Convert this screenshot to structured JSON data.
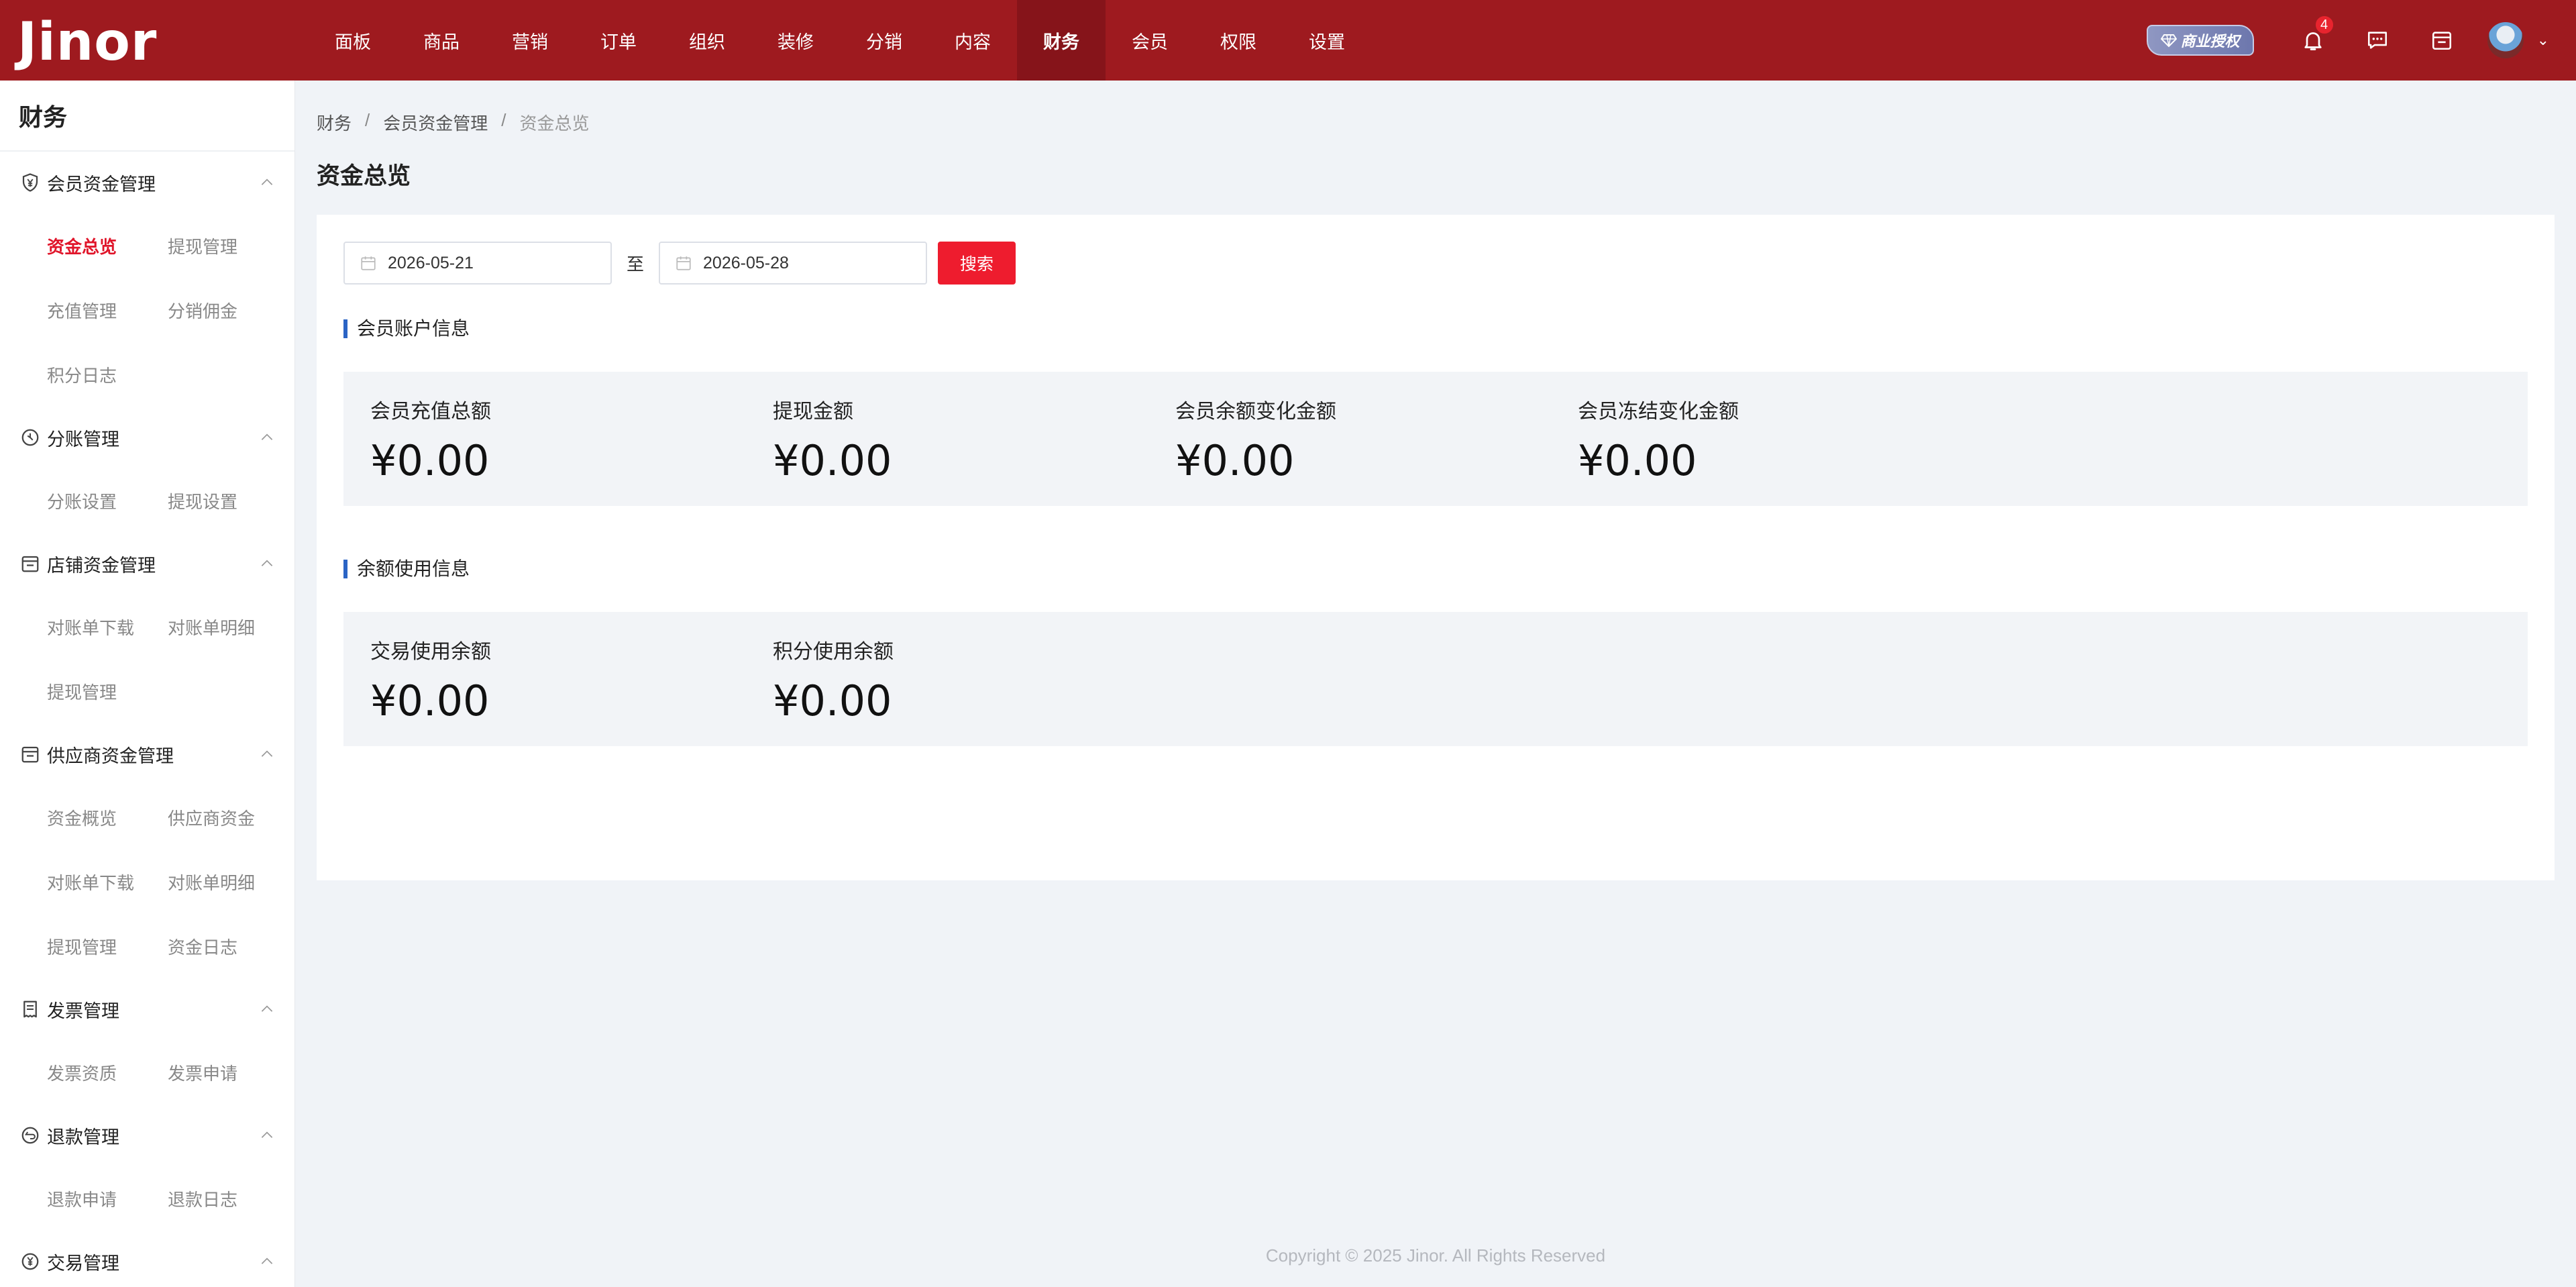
{
  "app": {
    "logo": "Jinor"
  },
  "nav": [
    {
      "label": "面板"
    },
    {
      "label": "商品"
    },
    {
      "label": "营销"
    },
    {
      "label": "订单"
    },
    {
      "label": "组织"
    },
    {
      "label": "装修"
    },
    {
      "label": "分销"
    },
    {
      "label": "内容"
    },
    {
      "label": "财务",
      "active": true
    },
    {
      "label": "会员"
    },
    {
      "label": "权限"
    },
    {
      "label": "设置"
    }
  ],
  "header": {
    "license_label": "商业授权",
    "notification_count": "4",
    "colors": {
      "bar": "#9e1a1f",
      "accent": "#ee1c2e"
    }
  },
  "sidebar": {
    "title": "财务",
    "groups": [
      {
        "label": "会员资金管理",
        "icon": "shield-yen-icon",
        "items": [
          "资金总览",
          "提现管理",
          "充值管理",
          "分销佣金",
          "积分日志"
        ]
      },
      {
        "label": "分账管理",
        "icon": "split-circle-icon",
        "items": [
          "分账设置",
          "提现设置"
        ]
      },
      {
        "label": "店铺资金管理",
        "icon": "store-icon",
        "items": [
          "对账单下载",
          "对账单明细",
          "提现管理"
        ]
      },
      {
        "label": "供应商资金管理",
        "icon": "store-icon",
        "items": [
          "资金概览",
          "供应商资金",
          "对账单下载",
          "对账单明细",
          "提现管理",
          "资金日志"
        ]
      },
      {
        "label": "发票管理",
        "icon": "invoice-icon",
        "items": [
          "发票资质",
          "发票申请"
        ]
      },
      {
        "label": "退款管理",
        "icon": "refund-circle-icon",
        "items": [
          "退款申请",
          "退款日志"
        ]
      },
      {
        "label": "交易管理",
        "icon": "yen-circle-icon",
        "items": []
      }
    ],
    "active_item": "资金总览"
  },
  "breadcrumb": [
    "财务",
    "会员资金管理",
    "资金总览"
  ],
  "breadcrumb_sep": "/",
  "page": {
    "title": "资金总览",
    "filter": {
      "start_date": "2026-05-21",
      "to_label": "至",
      "end_date": "2026-05-28",
      "search_label": "搜索"
    },
    "account_section": {
      "title": "会员账户信息",
      "stats": [
        {
          "label": "会员充值总额",
          "value": "¥0.00"
        },
        {
          "label": "提现金额",
          "value": "¥0.00"
        },
        {
          "label": "会员余额变化金额",
          "value": "¥0.00"
        },
        {
          "label": "会员冻结变化金额",
          "value": "¥0.00"
        }
      ]
    },
    "balance_section": {
      "title": "余额使用信息",
      "stats": [
        {
          "label": "交易使用余额",
          "value": "¥0.00"
        },
        {
          "label": "积分使用余额",
          "value": "¥0.00"
        }
      ]
    }
  },
  "footer": {
    "copyright": "Copyright © 2025 Jinor. All Rights Reserved"
  }
}
